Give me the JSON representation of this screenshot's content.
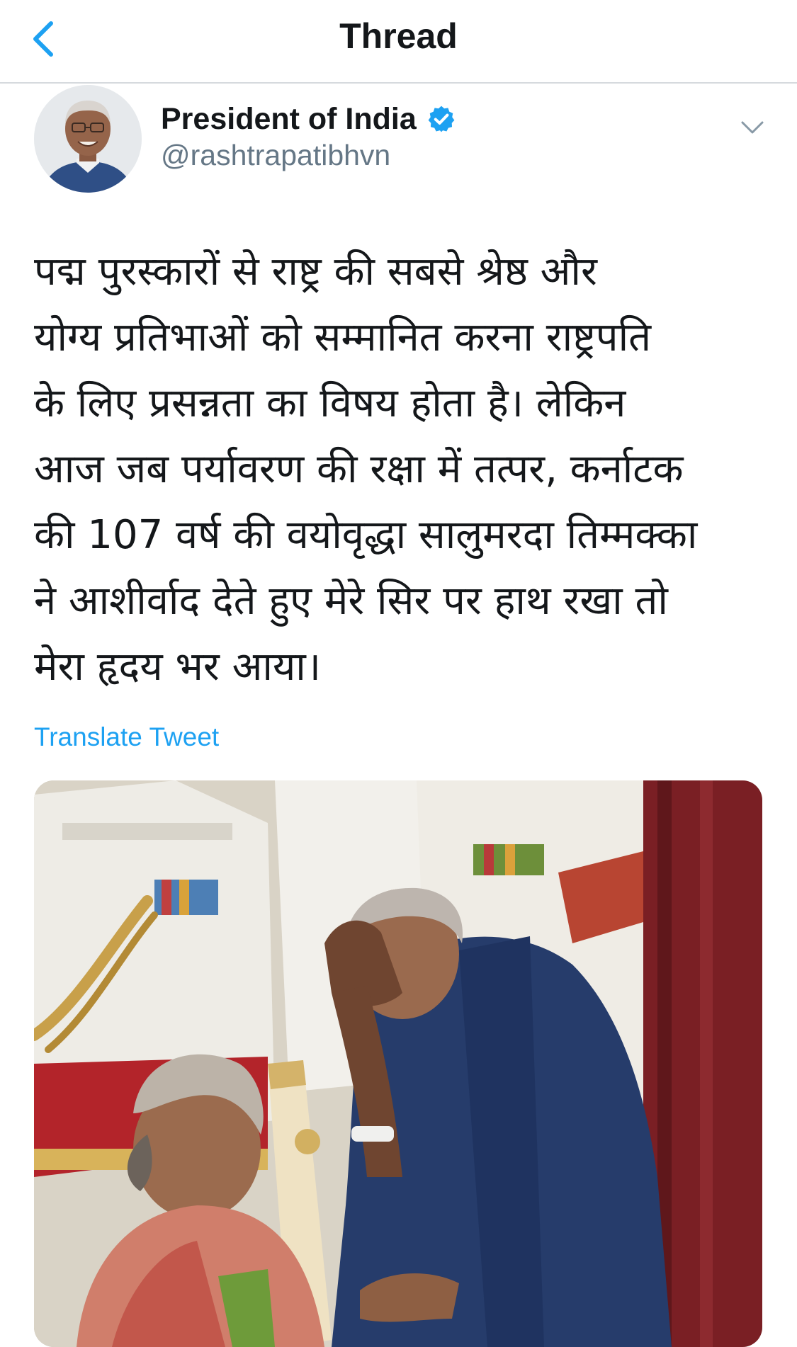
{
  "nav": {
    "title": "Thread"
  },
  "tweet": {
    "author": {
      "display_name": "President of India",
      "handle": "@rashtrapatibhvn",
      "verified": true
    },
    "text_lines": [
      "पद्म पुरस्कारों से राष्ट्र की सबसे श्रेष्ठ और",
      "योग्य प्रतिभाओं को सम्मानित करना राष्ट्रपति",
      "के लिए प्रसन्नता का विषय होता है। लेकिन",
      "आज जब पर्यावरण की रक्षा में तत्पर, कर्नाटक",
      "की 107 वर्ष की वयोवृद्धा सालुमरदा तिम्मक्का",
      "ने आशीर्वाद देते हुए मेरे सिर पर हाथ रखा तो",
      "मेरा हृदय भर आया।"
    ],
    "translate_label": "Translate Tweet"
  },
  "icons": {
    "back": "chevron-left-icon",
    "verified": "verified-badge-icon",
    "more": "chevron-down-icon"
  },
  "colors": {
    "accent": "#1da1f2",
    "text_primary": "#14171a",
    "text_secondary": "#657786",
    "divider": "#d6dade"
  }
}
